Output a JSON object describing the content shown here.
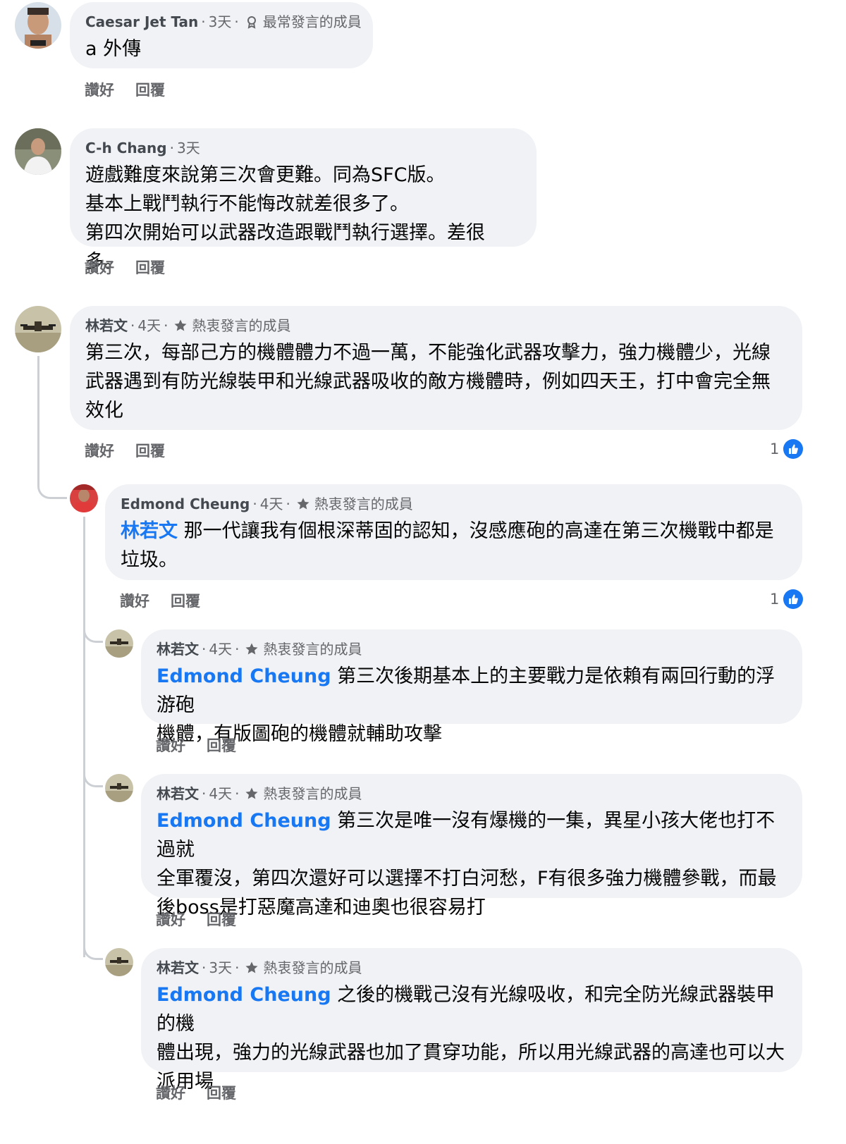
{
  "comments": [
    {
      "author": "Caesar Jet Tan",
      "time": "3天",
      "badge": "最常發言的成員",
      "badge_icon": "award-icon",
      "text": "a 外傳",
      "like_label": "讚好",
      "reply_label": "回覆"
    },
    {
      "author": "C-h Chang",
      "time": "3天",
      "lines": [
        "遊戲難度來說第三次會更難。同為SFC版。",
        "基本上戰鬥執行不能悔改就差很多了。",
        "第四次開始可以武器改造跟戰鬥執行選擇。差很多。"
      ],
      "like_label": "讚好",
      "reply_label": "回覆"
    },
    {
      "author": "林若文",
      "time": "4天",
      "badge": "熱衷發言的成員",
      "badge_icon": "star-icon",
      "lines": [
        "第三次，每部己方的機體體力不過一萬，不能強化武器攻擊力，強力機體少，光線",
        "武器遇到有防光線裝甲和光線武器吸收的敵方機體時，例如四天王，打中會完全無",
        "效化"
      ],
      "like_label": "讚好",
      "reply_label": "回覆",
      "reaction_count": "1"
    },
    {
      "author": "Edmond Cheung",
      "time": "4天",
      "badge": "熱衷發言的成員",
      "badge_icon": "star-icon",
      "mention": "林若文",
      "first_line": "那一代讓我有個根深蒂固的認知，沒感應砲的高達在第三次機戰中都是",
      "lines": [
        "垃圾。"
      ],
      "like_label": "讚好",
      "reply_label": "回覆",
      "reaction_count": "1"
    },
    {
      "author": "林若文",
      "time": "4天",
      "badge": "熱衷發言的成員",
      "badge_icon": "star-icon",
      "mention": "Edmond Cheung",
      "first_line": "第三次後期基本上的主要戰力是依賴有兩回行動的浮游砲",
      "lines": [
        "機體，有版圖砲的機體就輔助攻擊"
      ],
      "like_label": "讚好",
      "reply_label": "回覆"
    },
    {
      "author": "林若文",
      "time": "4天",
      "badge": "熱衷發言的成員",
      "badge_icon": "star-icon",
      "mention": "Edmond Cheung",
      "first_line": "第三次是唯一沒有爆機的一集，異星小孩大佬也打不過就",
      "lines": [
        "全軍覆沒，第四次還好可以選擇不打白河愁，F有很多強力機體參戰，而最",
        "後boss是打惡魔高達和迪奧也很容易打"
      ],
      "like_label": "讚好",
      "reply_label": "回覆"
    },
    {
      "author": "林若文",
      "time": "3天",
      "badge": "熱衷發言的成員",
      "badge_icon": "star-icon",
      "mention": "Edmond Cheung",
      "first_line": "之後的機戰己沒有光線吸收，和完全防光線武器裝甲的機",
      "lines": [
        "體出現，強力的光線武器也加了貫穿功能，所以用光線武器的高達也可以大",
        "派用場"
      ],
      "like_label": "讚好",
      "reply_label": "回覆"
    }
  ],
  "colors": {
    "mention": "#1877f2",
    "bubble": "#f0f2f5",
    "meta": "#65676b"
  }
}
